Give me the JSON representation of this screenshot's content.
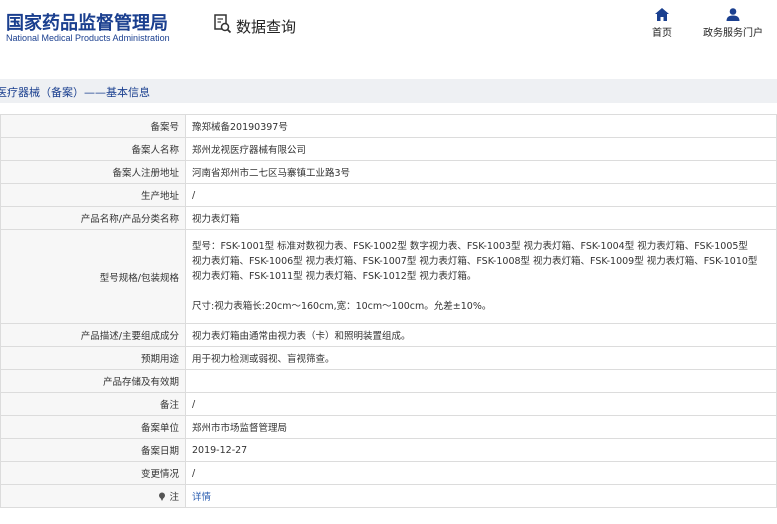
{
  "header": {
    "logo_cn": "国家药品监督管理局",
    "logo_en": "National Medical Products Administration",
    "query_label": "数据查询",
    "nav": {
      "home": "首页",
      "service": "政务服务门户"
    }
  },
  "subheader": {
    "title": "医疗器械（备案）——基本信息"
  },
  "rows": [
    {
      "label": "备案号",
      "value": "豫郑械备20190397号"
    },
    {
      "label": "备案人名称",
      "value": "郑州龙视医疗器械有限公司"
    },
    {
      "label": "备案人注册地址",
      "value": "河南省郑州市二七区马寨镇工业路3号"
    },
    {
      "label": "生产地址",
      "value": "/"
    },
    {
      "label": "产品名称/产品分类名称",
      "value": "视力表灯箱"
    },
    {
      "label": "型号规格/包装规格",
      "lines": [
        "型号：FSK-1001型 标准对数视力表、FSK-1002型 数字视力表、FSK-1003型 视力表灯箱、FSK-1004型 视力表灯箱、FSK-1005型",
        "视力表灯箱、FSK-1006型 视力表灯箱、FSK-1007型 视力表灯箱、FSK-1008型 视力表灯箱、FSK-1009型 视力表灯箱、FSK-1010型",
        "视力表灯箱、FSK-1011型 视力表灯箱、FSK-1012型 视力表灯箱。",
        "",
        "尺寸:视力表箱长:20cm～160cm,宽：10cm～100cm。允差±10%。"
      ]
    },
    {
      "label": "产品描述/主要组成成分",
      "value": "视力表灯箱由通常由视力表（卡）和照明装置组成。"
    },
    {
      "label": "预期用途",
      "value": "用于视力检测或弱视、盲视筛查。"
    },
    {
      "label": "产品存储及有效期",
      "value": ""
    },
    {
      "label": "备注",
      "value": "/"
    },
    {
      "label": "备案单位",
      "value": "郑州市市场监督管理局"
    },
    {
      "label": "备案日期",
      "value": "2019-12-27"
    },
    {
      "label": "变更情况",
      "value": "/"
    },
    {
      "label": "注",
      "value": "详情"
    }
  ],
  "colors": {
    "brand": "#1a3f8f",
    "link": "#2a5db0"
  },
  "icons": {
    "query": "search-document-icon",
    "home": "home-icon",
    "service": "user-icon",
    "note": "pin-icon"
  }
}
